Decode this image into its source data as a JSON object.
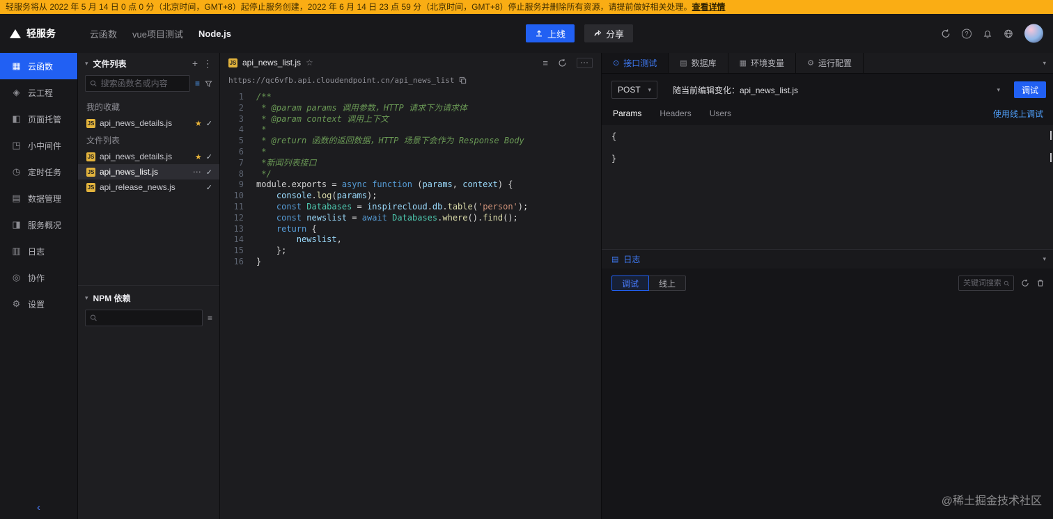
{
  "banner": {
    "text": "轻服务将从 2022 年 5 月 14 日 0 点 0 分（北京时间，GMT+8）起停止服务创建，2022 年 6 月 14 日 23 点 59 分（北京时间，GMT+8）停止服务并删除所有资源，请提前做好相关处理。",
    "link": "查看详情"
  },
  "nav": {
    "logo": "轻服务",
    "breadcrumb": [
      "云函数",
      "vue项目测试",
      "Node.js"
    ],
    "publish": "上线",
    "share": "分享"
  },
  "sidebar": {
    "items": [
      {
        "label": "云函数",
        "icon": "cloud-function",
        "active": true
      },
      {
        "label": "云工程",
        "icon": "cloud-project",
        "active": false
      },
      {
        "label": "页面托管",
        "icon": "page-hosting",
        "active": false
      },
      {
        "label": "小中间件",
        "icon": "middleware",
        "active": false
      },
      {
        "label": "定时任务",
        "icon": "timer",
        "active": false
      },
      {
        "label": "数据管理",
        "icon": "data-manage",
        "active": false
      },
      {
        "label": "服务概况",
        "icon": "service-overview",
        "active": false
      },
      {
        "label": "日志",
        "icon": "logs",
        "active": false
      },
      {
        "label": "协作",
        "icon": "collaboration",
        "active": false
      },
      {
        "label": "设置",
        "icon": "settings",
        "active": false
      }
    ]
  },
  "filePanel": {
    "title": "文件列表",
    "searchPlaceholder": "搜索函数名或内容",
    "favoritesLabel": "我的收藏",
    "favorites": [
      {
        "name": "api_news_details.js",
        "starred": true,
        "checked": true,
        "selected": false,
        "more": false
      }
    ],
    "filesLabel": "文件列表",
    "files": [
      {
        "name": "api_news_details.js",
        "starred": true,
        "checked": true,
        "selected": false,
        "more": false
      },
      {
        "name": "api_news_list.js",
        "starred": false,
        "checked": true,
        "selected": true,
        "more": true
      },
      {
        "name": "api_release_news.js",
        "starred": false,
        "checked": true,
        "selected": false,
        "more": false
      }
    ],
    "npmTitle": "NPM 依赖"
  },
  "editor": {
    "tab": "api_news_list.js",
    "url": "https://qc6vfb.api.cloudendpoint.cn/api_news_list",
    "code": [
      [
        [
          "c",
          "/**"
        ]
      ],
      [
        [
          "c",
          " * @param params 调用参数，HTTP 请求下为请求体"
        ]
      ],
      [
        [
          "c",
          " * @param context 调用上下文"
        ]
      ],
      [
        [
          "c",
          " *"
        ]
      ],
      [
        [
          "c",
          " * @return 函数的返回数据，HTTP 场景下会作为 Response Body"
        ]
      ],
      [
        [
          "c",
          " *"
        ]
      ],
      [
        [
          "c",
          " *新闻列表接口"
        ]
      ],
      [
        [
          "c",
          " */"
        ]
      ],
      [
        [
          "p",
          "module.exports = "
        ],
        [
          "k",
          "async"
        ],
        [
          "p",
          " "
        ],
        [
          "k",
          "function"
        ],
        [
          "p",
          " ("
        ],
        [
          "v",
          "params"
        ],
        [
          "p",
          ", "
        ],
        [
          "v",
          "context"
        ],
        [
          "p",
          ") {"
        ]
      ],
      [
        [
          "p",
          "    "
        ],
        [
          "v",
          "console"
        ],
        [
          "p",
          "."
        ],
        [
          "f",
          "log"
        ],
        [
          "p",
          "("
        ],
        [
          "v",
          "params"
        ],
        [
          "p",
          ");"
        ]
      ],
      [
        [
          "p",
          "    "
        ],
        [
          "k",
          "const"
        ],
        [
          "p",
          " "
        ],
        [
          "t",
          "Databases"
        ],
        [
          "p",
          " = "
        ],
        [
          "v",
          "inspirecloud"
        ],
        [
          "p",
          "."
        ],
        [
          "v",
          "db"
        ],
        [
          "p",
          "."
        ],
        [
          "f",
          "table"
        ],
        [
          "p",
          "("
        ],
        [
          "s",
          "'person'"
        ],
        [
          "p",
          ");"
        ]
      ],
      [
        [
          "p",
          "    "
        ],
        [
          "k",
          "const"
        ],
        [
          "p",
          " "
        ],
        [
          "v",
          "newslist"
        ],
        [
          "p",
          " = "
        ],
        [
          "k",
          "await"
        ],
        [
          "p",
          " "
        ],
        [
          "t",
          "Databases"
        ],
        [
          "p",
          "."
        ],
        [
          "f",
          "where"
        ],
        [
          "p",
          "()."
        ],
        [
          "f",
          "find"
        ],
        [
          "p",
          "();"
        ]
      ],
      [
        [
          "p",
          "    "
        ],
        [
          "k",
          "return"
        ],
        [
          "p",
          " {"
        ]
      ],
      [
        [
          "p",
          "        "
        ],
        [
          "v",
          "newslist"
        ],
        [
          "p",
          ","
        ]
      ],
      [
        [
          "p",
          "    };"
        ]
      ],
      [
        [
          "p",
          "}"
        ]
      ]
    ]
  },
  "rightPanel": {
    "tabs": [
      {
        "label": "接口测试",
        "icon": "api-test",
        "active": true
      },
      {
        "label": "数据库",
        "icon": "database",
        "active": false
      },
      {
        "label": "环境变量",
        "icon": "env-vars",
        "active": false
      },
      {
        "label": "运行配置",
        "icon": "run-config",
        "active": false
      }
    ],
    "method": "POST",
    "binding": "随当前编辑变化：api_news_list.js",
    "debug": "调试",
    "paramTabs": [
      "Params",
      "Headers",
      "Users"
    ],
    "onlineDebug": "使用线上调试",
    "jsonLines": [
      "{",
      "",
      "}"
    ],
    "log": {
      "title": "日志",
      "modes": [
        {
          "label": "调试",
          "active": true
        },
        {
          "label": "线上",
          "active": false
        }
      ],
      "searchPlaceholder": "关键词搜索"
    }
  },
  "watermark": "@稀土掘金技术社区",
  "colors": {
    "accent": "#2160f3",
    "banner": "#faad14",
    "star": "#e8b339",
    "jsBadge": "#e2b33d"
  }
}
